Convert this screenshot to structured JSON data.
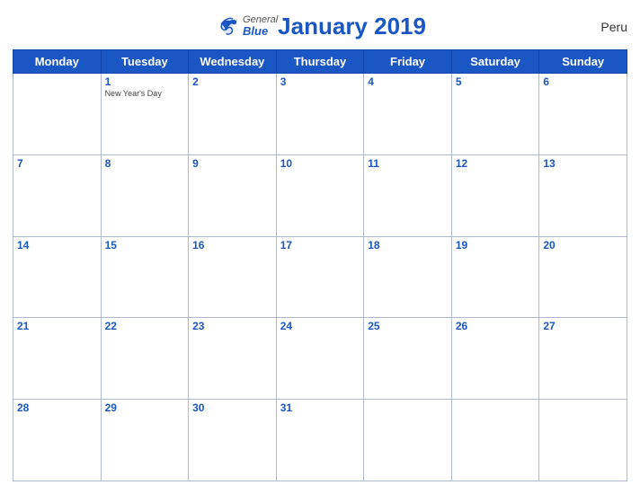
{
  "header": {
    "title": "January 2019",
    "country": "Peru",
    "logo_general": "General",
    "logo_blue": "Blue"
  },
  "weekdays": [
    "Monday",
    "Tuesday",
    "Wednesday",
    "Thursday",
    "Friday",
    "Saturday",
    "Sunday"
  ],
  "weeks": [
    [
      {
        "day": "",
        "holiday": ""
      },
      {
        "day": "1",
        "holiday": "New Year's Day"
      },
      {
        "day": "2",
        "holiday": ""
      },
      {
        "day": "3",
        "holiday": ""
      },
      {
        "day": "4",
        "holiday": ""
      },
      {
        "day": "5",
        "holiday": ""
      },
      {
        "day": "6",
        "holiday": ""
      }
    ],
    [
      {
        "day": "7",
        "holiday": ""
      },
      {
        "day": "8",
        "holiday": ""
      },
      {
        "day": "9",
        "holiday": ""
      },
      {
        "day": "10",
        "holiday": ""
      },
      {
        "day": "11",
        "holiday": ""
      },
      {
        "day": "12",
        "holiday": ""
      },
      {
        "day": "13",
        "holiday": ""
      }
    ],
    [
      {
        "day": "14",
        "holiday": ""
      },
      {
        "day": "15",
        "holiday": ""
      },
      {
        "day": "16",
        "holiday": ""
      },
      {
        "day": "17",
        "holiday": ""
      },
      {
        "day": "18",
        "holiday": ""
      },
      {
        "day": "19",
        "holiday": ""
      },
      {
        "day": "20",
        "holiday": ""
      }
    ],
    [
      {
        "day": "21",
        "holiday": ""
      },
      {
        "day": "22",
        "holiday": ""
      },
      {
        "day": "23",
        "holiday": ""
      },
      {
        "day": "24",
        "holiday": ""
      },
      {
        "day": "25",
        "holiday": ""
      },
      {
        "day": "26",
        "holiday": ""
      },
      {
        "day": "27",
        "holiday": ""
      }
    ],
    [
      {
        "day": "28",
        "holiday": ""
      },
      {
        "day": "29",
        "holiday": ""
      },
      {
        "day": "30",
        "holiday": ""
      },
      {
        "day": "31",
        "holiday": ""
      },
      {
        "day": "",
        "holiday": ""
      },
      {
        "day": "",
        "holiday": ""
      },
      {
        "day": "",
        "holiday": ""
      }
    ]
  ]
}
